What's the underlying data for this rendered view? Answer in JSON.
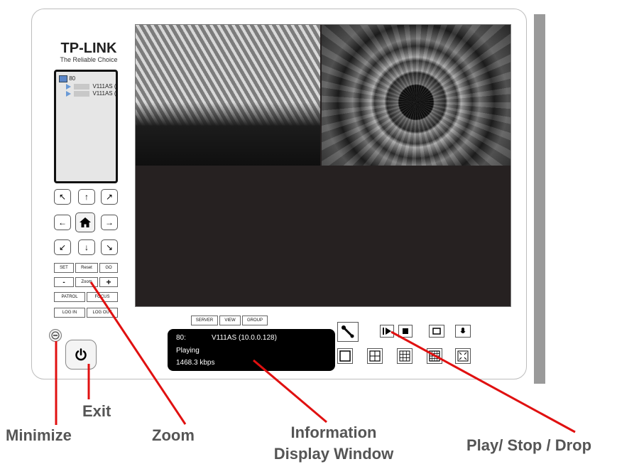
{
  "brand": {
    "name": "TP-LINK",
    "tagline": "The Reliable Choice"
  },
  "device_tree": {
    "root": "80",
    "items": [
      "V111AS (",
      "V111AS ("
    ]
  },
  "ptz": {
    "buttons": [
      "up-left",
      "up",
      "up-right",
      "left",
      "home",
      "right",
      "down-left",
      "down",
      "down-right"
    ]
  },
  "preset": {
    "set_label": "SET",
    "reset_label": "Reset",
    "go_label": "GO"
  },
  "zoom": {
    "minus_label": "-",
    "zoom_label": "Zoom",
    "plus_label": "+"
  },
  "patrol": {
    "patrol_label": "PATROL",
    "focus_label": "FOCUS"
  },
  "account": {
    "login_label": "LOG IN",
    "logout_label": "LOG OUT"
  },
  "tabs": [
    "SERVER",
    "VIEW",
    "GROUP"
  ],
  "info_window": {
    "channel": "80:",
    "camera": "V111AS (10.0.0.128)",
    "status": "Playing",
    "bitrate": "1468.3 kbps"
  },
  "callouts": {
    "exit": "Exit",
    "minimize": "Minimize",
    "zoom": "Zoom",
    "info_line1": "Information",
    "info_line2": "Display Window",
    "play_stop": "Play/ Stop / Drop"
  },
  "colors": {
    "annotation_line": "#e01010",
    "callout_text": "#555555",
    "video_bg": "#262121"
  }
}
